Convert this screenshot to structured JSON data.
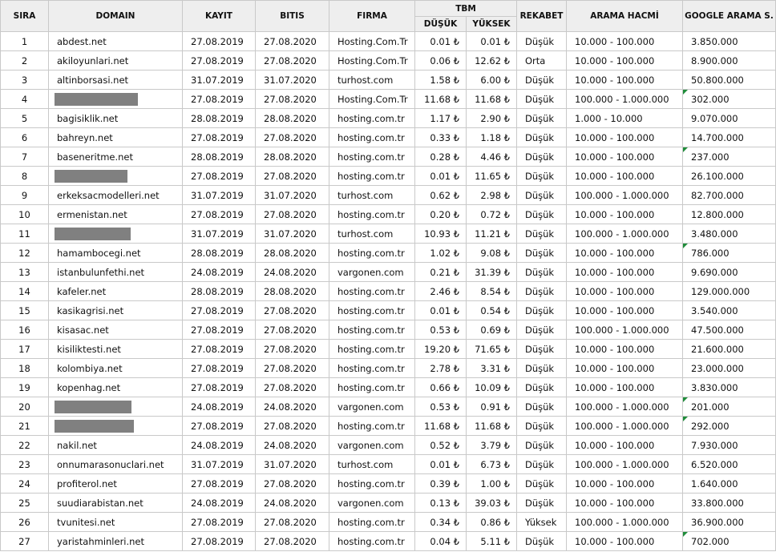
{
  "headers": {
    "sira": "SIRA",
    "domain": "DOMAIN",
    "kayit": "KAYIT",
    "bitis": "BITIS",
    "firma": "FIRMA",
    "tbm": "TBM",
    "dusuk": "DÜŞÜK",
    "yuksek": "YÜKSEK",
    "rekabet": "REKABET",
    "arama_hacmi": "ARAMA HACMİ",
    "google": "GOOGLE ARAMA S."
  },
  "colors": {
    "header_bg": "#eeeeee",
    "grid": "#c9c9c9",
    "redaction": "#808080",
    "comment_flag": "#1f8c3a"
  },
  "rows": [
    {
      "sira": "1",
      "domain": "abdest.net",
      "kayit": "27.08.2019",
      "bitis": "27.08.2020",
      "firma": "Hosting.Com.Tr",
      "dusuk": "0.01 ₺",
      "yuksek": "0.01 ₺",
      "rekabet": "Düşük",
      "hacim": "10.000 - 100.000",
      "google": "3.850.000",
      "flag": false
    },
    {
      "sira": "2",
      "domain": "akiloyunlari.net",
      "kayit": "27.08.2019",
      "bitis": "27.08.2020",
      "firma": "Hosting.Com.Tr",
      "dusuk": "0.06 ₺",
      "yuksek": "12.62 ₺",
      "rekabet": "Orta",
      "hacim": "10.000 - 100.000",
      "google": "8.900.000",
      "flag": false
    },
    {
      "sira": "3",
      "domain": "altinborsasi.net",
      "kayit": "31.07.2019",
      "bitis": "31.07.2020",
      "firma": "turhost.com",
      "dusuk": "1.58 ₺",
      "yuksek": "6.00 ₺",
      "rekabet": "Düşük",
      "hacim": "10.000 - 100.000",
      "google": "50.800.000",
      "flag": false
    },
    {
      "sira": "4",
      "domain": "",
      "redacted": true,
      "redact_width": 104,
      "kayit": "27.08.2019",
      "bitis": "27.08.2020",
      "firma": "Hosting.Com.Tr",
      "dusuk": "11.68 ₺",
      "yuksek": "11.68 ₺",
      "rekabet": "Düşük",
      "hacim": "100.000 - 1.000.000",
      "google": "302.000",
      "flag": true
    },
    {
      "sira": "5",
      "domain": "bagisiklik.net",
      "kayit": "28.08.2019",
      "bitis": "28.08.2020",
      "firma": "hosting.com.tr",
      "dusuk": "1.17 ₺",
      "yuksek": "2.90 ₺",
      "rekabet": "Düşük",
      "hacim": "1.000 - 10.000",
      "google": "9.070.000",
      "flag": false
    },
    {
      "sira": "6",
      "domain": "bahreyn.net",
      "kayit": "27.08.2019",
      "bitis": "27.08.2020",
      "firma": "hosting.com.tr",
      "dusuk": "0.33 ₺",
      "yuksek": "1.18 ₺",
      "rekabet": "Düşük",
      "hacim": "10.000 - 100.000",
      "google": "14.700.000",
      "flag": false
    },
    {
      "sira": "7",
      "domain": "baseneritme.net",
      "kayit": "28.08.2019",
      "bitis": "28.08.2020",
      "firma": "hosting.com.tr",
      "dusuk": "0.28 ₺",
      "yuksek": "4.46 ₺",
      "rekabet": "Düşük",
      "hacim": "10.000 - 100.000",
      "google": "237.000",
      "flag": true
    },
    {
      "sira": "8",
      "domain": "",
      "redacted": true,
      "redact_width": 91,
      "kayit": "27.08.2019",
      "bitis": "27.08.2020",
      "firma": "hosting.com.tr",
      "dusuk": "0.01 ₺",
      "yuksek": "11.65 ₺",
      "rekabet": "Düşük",
      "hacim": "10.000 - 100.000",
      "google": "26.100.000",
      "flag": false
    },
    {
      "sira": "9",
      "domain": "erkeksacmodelleri.net",
      "kayit": "31.07.2019",
      "bitis": "31.07.2020",
      "firma": "turhost.com",
      "dusuk": "0.62 ₺",
      "yuksek": "2.98 ₺",
      "rekabet": "Düşük",
      "hacim": "100.000 - 1.000.000",
      "google": "82.700.000",
      "flag": false
    },
    {
      "sira": "10",
      "domain": "ermenistan.net",
      "kayit": "27.08.2019",
      "bitis": "27.08.2020",
      "firma": "hosting.com.tr",
      "dusuk": "0.20 ₺",
      "yuksek": "0.72 ₺",
      "rekabet": "Düşük",
      "hacim": "10.000 - 100.000",
      "google": "12.800.000",
      "flag": false
    },
    {
      "sira": "11",
      "domain": "",
      "redacted": true,
      "redact_width": 95,
      "kayit": "31.07.2019",
      "bitis": "31.07.2020",
      "firma": "turhost.com",
      "dusuk": "10.93 ₺",
      "yuksek": "11.21 ₺",
      "rekabet": "Düşük",
      "hacim": "100.000 - 1.000.000",
      "google": "3.480.000",
      "flag": false
    },
    {
      "sira": "12",
      "domain": "hamambocegi.net",
      "kayit": "28.08.2019",
      "bitis": "28.08.2020",
      "firma": "hosting.com.tr",
      "dusuk": "1.02 ₺",
      "yuksek": "9.08 ₺",
      "rekabet": "Düşük",
      "hacim": "10.000 - 100.000",
      "google": "786.000",
      "flag": true
    },
    {
      "sira": "13",
      "domain": "istanbulunfethi.net",
      "kayit": "24.08.2019",
      "bitis": "24.08.2020",
      "firma": "vargonen.com",
      "dusuk": "0.21 ₺",
      "yuksek": "31.39 ₺",
      "rekabet": "Düşük",
      "hacim": "10.000 - 100.000",
      "google": "9.690.000",
      "flag": false
    },
    {
      "sira": "14",
      "domain": "kafeler.net",
      "kayit": "28.08.2019",
      "bitis": "28.08.2020",
      "firma": "hosting.com.tr",
      "dusuk": "2.46 ₺",
      "yuksek": "8.54 ₺",
      "rekabet": "Düşük",
      "hacim": "10.000 - 100.000",
      "google": "129.000.000",
      "flag": false
    },
    {
      "sira": "15",
      "domain": "kasikagrisi.net",
      "kayit": "27.08.2019",
      "bitis": "27.08.2020",
      "firma": "hosting.com.tr",
      "dusuk": "0.01 ₺",
      "yuksek": "0.54 ₺",
      "rekabet": "Düşük",
      "hacim": "10.000 - 100.000",
      "google": "3.540.000",
      "flag": false
    },
    {
      "sira": "16",
      "domain": "kisasac.net",
      "kayit": "27.08.2019",
      "bitis": "27.08.2020",
      "firma": "hosting.com.tr",
      "dusuk": "0.53 ₺",
      "yuksek": "0.69 ₺",
      "rekabet": "Düşük",
      "hacim": "100.000 - 1.000.000",
      "google": "47.500.000",
      "flag": false
    },
    {
      "sira": "17",
      "domain": "kisiliktesti.net",
      "kayit": "27.08.2019",
      "bitis": "27.08.2020",
      "firma": "hosting.com.tr",
      "dusuk": "19.20 ₺",
      "yuksek": "71.65 ₺",
      "rekabet": "Düşük",
      "hacim": "10.000 - 100.000",
      "google": "21.600.000",
      "flag": false
    },
    {
      "sira": "18",
      "domain": "kolombiya.net",
      "kayit": "27.08.2019",
      "bitis": "27.08.2020",
      "firma": "hosting.com.tr",
      "dusuk": "2.78 ₺",
      "yuksek": "3.31 ₺",
      "rekabet": "Düşük",
      "hacim": "10.000 - 100.000",
      "google": "23.000.000",
      "flag": false
    },
    {
      "sira": "19",
      "domain": "kopenhag.net",
      "kayit": "27.08.2019",
      "bitis": "27.08.2020",
      "firma": "hosting.com.tr",
      "dusuk": "0.66 ₺",
      "yuksek": "10.09 ₺",
      "rekabet": "Düşük",
      "hacim": "10.000 - 100.000",
      "google": "3.830.000",
      "flag": false
    },
    {
      "sira": "20",
      "domain": "",
      "redacted": true,
      "redact_width": 96,
      "kayit": "24.08.2019",
      "bitis": "24.08.2020",
      "firma": "vargonen.com",
      "dusuk": "0.53 ₺",
      "yuksek": "0.91 ₺",
      "rekabet": "Düşük",
      "hacim": "100.000 - 1.000.000",
      "google": "201.000",
      "flag": true
    },
    {
      "sira": "21",
      "domain": "",
      "redacted": true,
      "redact_width": 99,
      "kayit": "27.08.2019",
      "bitis": "27.08.2020",
      "firma": "hosting.com.tr",
      "dusuk": "11.68 ₺",
      "yuksek": "11.68 ₺",
      "rekabet": "Düşük",
      "hacim": "100.000 - 1.000.000",
      "google": "292.000",
      "flag": true
    },
    {
      "sira": "22",
      "domain": "nakil.net",
      "kayit": "24.08.2019",
      "bitis": "24.08.2020",
      "firma": "vargonen.com",
      "dusuk": "0.52 ₺",
      "yuksek": "3.79 ₺",
      "rekabet": "Düşük",
      "hacim": "10.000 - 100.000",
      "google": "7.930.000",
      "flag": false
    },
    {
      "sira": "23",
      "domain": "onnumarasonuclari.net",
      "kayit": "31.07.2019",
      "bitis": "31.07.2020",
      "firma": "turhost.com",
      "dusuk": "0.01 ₺",
      "yuksek": "6.73 ₺",
      "rekabet": "Düşük",
      "hacim": "100.000 - 1.000.000",
      "google": "6.520.000",
      "flag": false
    },
    {
      "sira": "24",
      "domain": "profiterol.net",
      "kayit": "27.08.2019",
      "bitis": "27.08.2020",
      "firma": "hosting.com.tr",
      "dusuk": "0.39 ₺",
      "yuksek": "1.00 ₺",
      "rekabet": "Düşük",
      "hacim": "10.000 - 100.000",
      "google": "1.640.000",
      "flag": false
    },
    {
      "sira": "25",
      "domain": "suudiarabistan.net",
      "kayit": "24.08.2019",
      "bitis": "24.08.2020",
      "firma": "vargonen.com",
      "dusuk": "0.13 ₺",
      "yuksek": "39.03 ₺",
      "rekabet": "Düşük",
      "hacim": "10.000 - 100.000",
      "google": "33.800.000",
      "flag": false
    },
    {
      "sira": "26",
      "domain": "tvunitesi.net",
      "kayit": "27.08.2019",
      "bitis": "27.08.2020",
      "firma": "hosting.com.tr",
      "dusuk": "0.34 ₺",
      "yuksek": "0.86 ₺",
      "rekabet": "Yüksek",
      "hacim": "100.000 - 1.000.000",
      "google": "36.900.000",
      "flag": false
    },
    {
      "sira": "27",
      "domain": "yaristahminleri.net",
      "kayit": "27.08.2019",
      "bitis": "27.08.2020",
      "firma": "hosting.com.tr",
      "dusuk": "0.04 ₺",
      "yuksek": "5.11 ₺",
      "rekabet": "Düşük",
      "hacim": "10.000 - 100.000",
      "google": "702.000",
      "flag": true
    }
  ]
}
